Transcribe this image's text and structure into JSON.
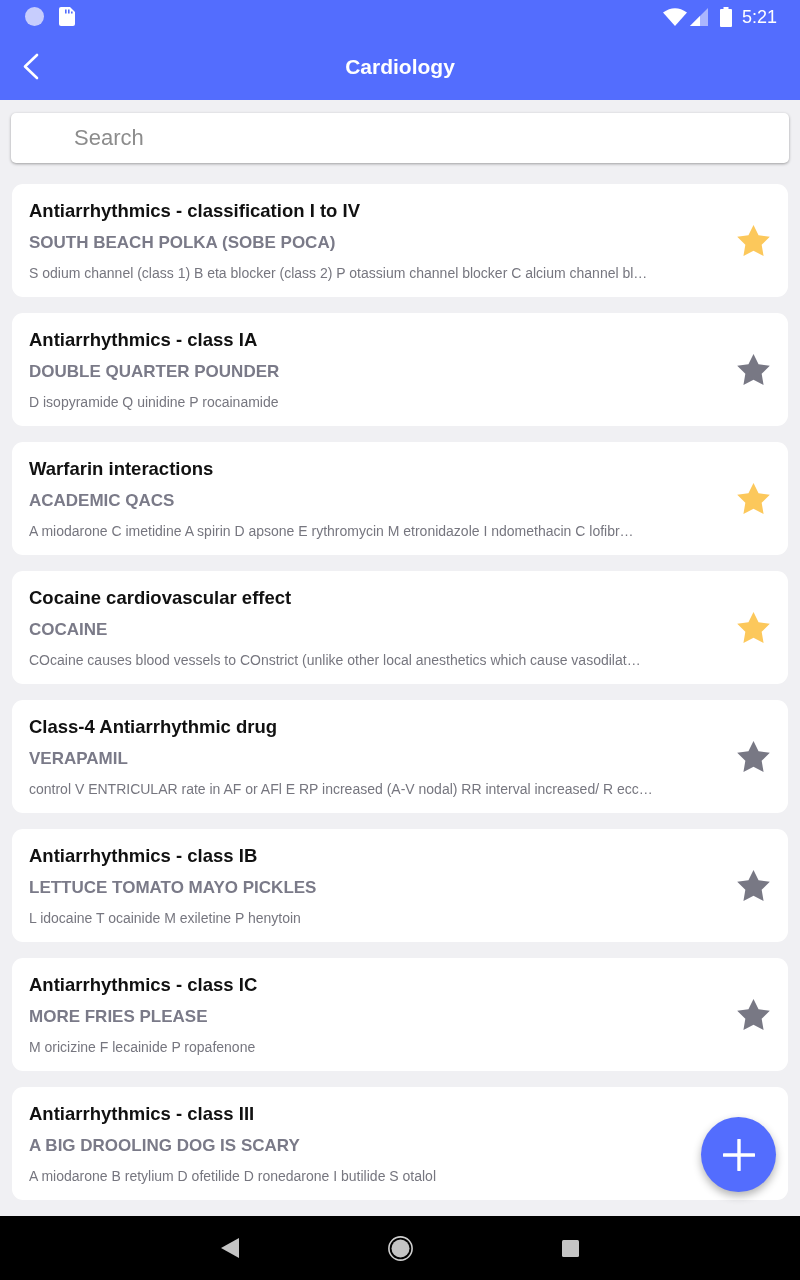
{
  "status_bar": {
    "time": "5:21"
  },
  "app_bar": {
    "title": "Cardiology"
  },
  "search": {
    "placeholder": "Search"
  },
  "cards": [
    {
      "title": "Antiarrhythmics - classification I to IV",
      "mnemonic": "SOUTH BEACH POLKA (SOBE POCA)",
      "description": "S odium channel (class 1) B eta blocker (class 2) P otassium channel blocker C alcium channel bl…",
      "starred": true
    },
    {
      "title": "Antiarrhythmics - class IA",
      "mnemonic": "DOUBLE QUARTER POUNDER",
      "description": "D isopyramide Q uinidine P rocainamide",
      "starred": false
    },
    {
      "title": "Warfarin interactions",
      "mnemonic": "ACADEMIC QACS",
      "description": "A miodarone C imetidine A spirin D apsone E rythromycin M etronidazole I ndomethacin C lofibr…",
      "starred": true
    },
    {
      "title": "Cocaine cardiovascular effect",
      "mnemonic": "COCAINE",
      "description": "COcaine causes blood vessels to COnstrict (unlike other local anesthetics which cause vasodilat…",
      "starred": true
    },
    {
      "title": "Class-4 Antiarrhythmic drug",
      "mnemonic": "VERAPAMIL",
      "description": "control V ENTRICULAR rate in AF or AFl E RP increased (A-V nodal) RR interval increased/ R ecc…",
      "starred": false
    },
    {
      "title": "Antiarrhythmics - class IB",
      "mnemonic": "LETTUCE TOMATO MAYO PICKLES",
      "description": "L idocaine T ocainide M exiletine P henytoin",
      "starred": false
    },
    {
      "title": "Antiarrhythmics - class IC",
      "mnemonic": "MORE FRIES PLEASE",
      "description": "M oricizine F lecainide P ropafenone",
      "starred": false
    },
    {
      "title": "Antiarrhythmics - class III",
      "mnemonic": "A BIG DROOLING DOG IS SCARY",
      "description": "A miodarone B retylium D ofetilide D ronedarone I butilide S otalol"
    }
  ]
}
